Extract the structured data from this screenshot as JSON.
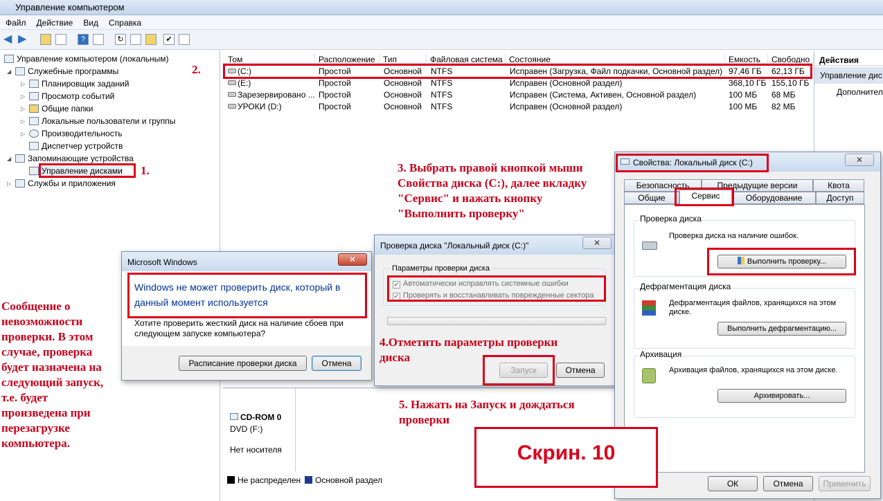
{
  "window": {
    "title": "Управление компьютером"
  },
  "menu": [
    "Файл",
    "Действие",
    "Вид",
    "Справка"
  ],
  "tree": {
    "root": "Управление компьютером (локальным)",
    "items": [
      {
        "label": "Служебные программы"
      },
      {
        "label": "Планировщик заданий"
      },
      {
        "label": "Просмотр событий"
      },
      {
        "label": "Общие папки"
      },
      {
        "label": "Локальные пользователи и группы"
      },
      {
        "label": "Производительность"
      },
      {
        "label": "Диспетчер устройств"
      },
      {
        "label": "Запоминающие устройства"
      },
      {
        "label": "Управление дисками"
      },
      {
        "label": "Службы и приложения"
      }
    ]
  },
  "volumes": {
    "headers": [
      "Том",
      "Расположение",
      "Тип",
      "Файловая система",
      "Состояние",
      "Емкость",
      "Свободно"
    ],
    "rows": [
      [
        "(C:)",
        "Простой",
        "Основной",
        "NTFS",
        "Исправен (Загрузка, Файл подкачки, Основной раздел)",
        "97,46 ГБ",
        "62,13 ГБ"
      ],
      [
        "(E:)",
        "Простой",
        "Основной",
        "NTFS",
        "Исправен (Основной раздел)",
        "368,10 ГБ",
        "155,10 ГБ"
      ],
      [
        "Зарезервировано ...",
        "Простой",
        "Основной",
        "NTFS",
        "Исправен (Система, Активен, Основной раздел)",
        "100 МБ",
        "68 МБ"
      ],
      [
        "УРОКИ (D:)",
        "Простой",
        "Основной",
        "NTFS",
        "Исправен (Основной раздел)",
        "100 МБ",
        "82 МБ"
      ]
    ]
  },
  "lower": {
    "cdrom_label": "CD-ROM 0",
    "cdrom_drive": "DVD (F:)",
    "cdrom_media": "Нет носителя",
    "legend_unallocated": "Не распределен",
    "legend_primary": "Основной раздел"
  },
  "actions": {
    "header": "Действия",
    "item1": "Управление дис",
    "item2": "Дополнител"
  },
  "ms_dialog": {
    "title": "Microsoft Windows",
    "message": "Windows не может проверить диск, который в данный момент используется",
    "question": "Хотите проверить жесткий диск на наличие сбоев при следующем запуске компьютера?",
    "schedule_button": "Расписание проверки диска",
    "cancel_button": "Отмена"
  },
  "check_dialog": {
    "title": "Проверка диска \"Локальный диск (C:)\"",
    "group": "Параметры проверки диска",
    "option1": "Автоматически исправлять системные ошибки",
    "option2": "Проверять и восстанавливать поврежденные сектора",
    "start_button": "Запуск",
    "cancel_button": "Отмена"
  },
  "props_dialog": {
    "title": "Свойства: Локальный диск (C:)",
    "tabs_row1": [
      "Безопасность",
      "Предыдущие версии",
      "Квота"
    ],
    "tabs_row2": [
      "Общие",
      "Сервис",
      "Оборудование",
      "Доступ"
    ],
    "check_group": "Проверка диска",
    "check_text": "Проверка диска на наличие ошибок.",
    "check_button": "Выполнить проверку...",
    "defrag_group": "Дефрагментация диска",
    "defrag_text": "Дефрагментация файлов, хранящихся на этом диске.",
    "defrag_button": "Выполнить дефрагментацию...",
    "archive_group": "Архивация",
    "archive_text": "Архивация файлов, хранящихся на этом диске.",
    "archive_button": "Архивировать...",
    "ok_button": "ОК",
    "cancel_button": "Отмена",
    "apply_button": "Применить"
  },
  "annotations": {
    "a1": "1.",
    "a2": "2.",
    "a3": "3. Выбрать правой кнопкой мыши\nСвойства диска (С:), далее вкладку\n\"Сервис\" и нажать кнопку\n\"Выполнить проверку\"",
    "a4": "4.Отметить параметры проверки\nдиска",
    "a5": "5. Нажать на Запуск и дождаться\nпроверки",
    "left": "Сообщение о\nневозможности\nпроверки. В этом\nслучае, проверка\nбудет назначена на\nследующий запуск,\nт.е. будет\nпроизведена при\nперезагрузке\nкомпьютера.",
    "screen": "Скрин. 10"
  },
  "colors": {
    "annotation": "#c8001a",
    "highlight": "#d9001b"
  }
}
